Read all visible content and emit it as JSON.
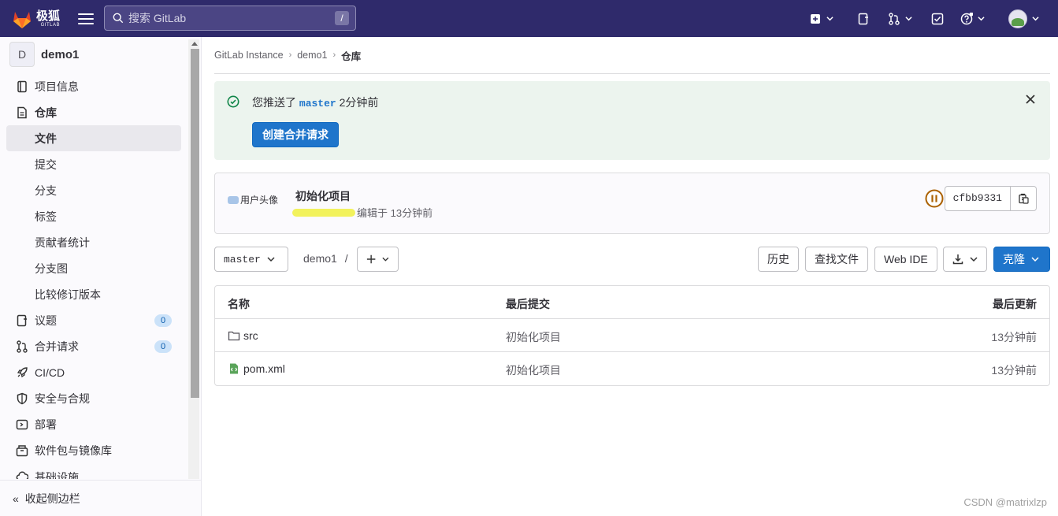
{
  "brand": {
    "name": "极狐",
    "sub": "GITLAB"
  },
  "search": {
    "placeholder": "搜索 GitLab",
    "shortcut": "/"
  },
  "project": {
    "initial": "D",
    "name": "demo1"
  },
  "sidebar": {
    "items": [
      {
        "label": "项目信息",
        "icon": "info-icon"
      },
      {
        "label": "仓库",
        "icon": "document-icon"
      },
      {
        "label": "文件"
      },
      {
        "label": "提交"
      },
      {
        "label": "分支"
      },
      {
        "label": "标签"
      },
      {
        "label": "贡献者统计"
      },
      {
        "label": "分支图"
      },
      {
        "label": "比较修订版本"
      },
      {
        "label": "议题",
        "icon": "issues-icon",
        "count": "0"
      },
      {
        "label": "合并请求",
        "icon": "merge-request-icon",
        "count": "0"
      },
      {
        "label": "CI/CD",
        "icon": "rocket-icon"
      },
      {
        "label": "安全与合规",
        "icon": "shield-icon"
      },
      {
        "label": "部署",
        "icon": "deploy-icon"
      },
      {
        "label": "软件包与镜像库",
        "icon": "package-icon"
      },
      {
        "label": "基础设施",
        "icon": "cloud-icon"
      }
    ],
    "collapse_label": "收起侧边栏"
  },
  "breadcrumb": [
    "GitLab Instance",
    "demo1",
    "仓库"
  ],
  "alert": {
    "prefix": "您推送了",
    "branch": "master",
    "suffix": "2分钟前",
    "button": "创建合并请求"
  },
  "commit": {
    "avatar_alt": "用户头像",
    "title": "初始化项目",
    "meta": "编辑于 13分钟前",
    "sha": "cfbb9331"
  },
  "toolbar": {
    "branch": "master",
    "path": "demo1",
    "path_sep": "/",
    "history": "历史",
    "find": "查找文件",
    "webide": "Web IDE",
    "clone": "克隆"
  },
  "table": {
    "headers": [
      "名称",
      "最后提交",
      "最后更新"
    ],
    "rows": [
      {
        "name": "src",
        "type": "folder",
        "commit": "初始化项目",
        "updated": "13分钟前"
      },
      {
        "name": "pom.xml",
        "type": "file",
        "commit": "初始化项目",
        "updated": "13分钟前"
      }
    ]
  },
  "watermark": "CSDN @matrixlzp",
  "colors": {
    "topbar": "#2f2a6b",
    "primary": "#1f75cb",
    "success": "#108548",
    "pipeline": "#ab6100"
  }
}
